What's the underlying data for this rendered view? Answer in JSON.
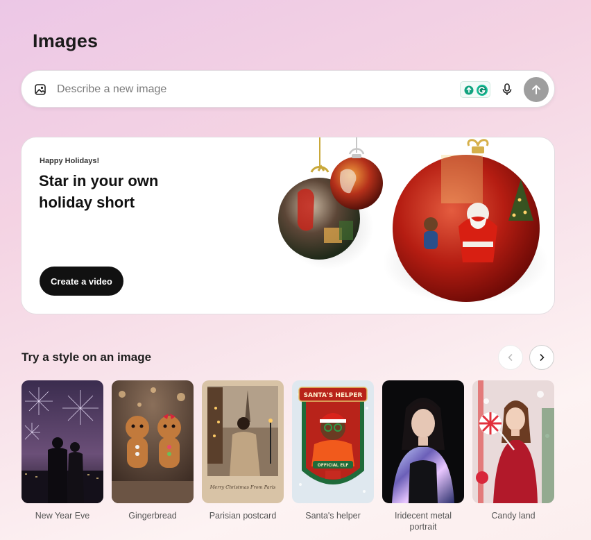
{
  "page": {
    "title": "Images"
  },
  "prompt": {
    "placeholder": "Describe a new image"
  },
  "promo": {
    "eyebrow": "Happy Holidays!",
    "heading": "Star in your own holiday short",
    "cta_label": "Create a video"
  },
  "styles_section": {
    "title": "Try a style on an image",
    "items": [
      {
        "label": "New Year Eve"
      },
      {
        "label": "Gingerbread"
      },
      {
        "label": "Parisian postcard"
      },
      {
        "label": "Santa's helper"
      },
      {
        "label": "Iridecent metal portrait"
      },
      {
        "label": "Candy land"
      }
    ]
  },
  "thumb_text": {
    "postcard_caption": "Merry Christmas From Paris",
    "santas_helper_banner": "SANTA'S HELPER",
    "santas_helper_badge": "OFFICIAL ELF"
  },
  "colors": {
    "accent_dark": "#111111",
    "send_button": "#9e9e9e",
    "ornament_red": "#b51d12"
  },
  "icons": {
    "prompt_left": "image-icon",
    "extension": "grammarly-icon",
    "mic": "microphone-icon",
    "send": "arrow-up-icon",
    "prev": "chevron-left-icon",
    "next": "chevron-right-icon"
  }
}
